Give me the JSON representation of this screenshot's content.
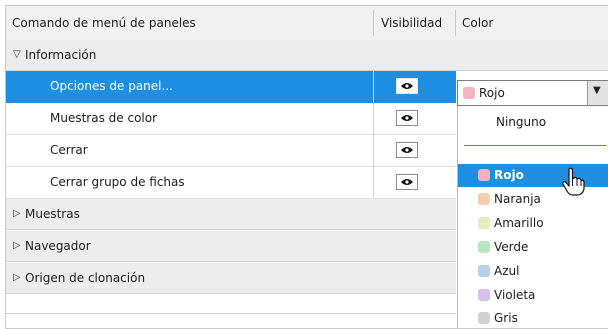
{
  "header": {
    "col_command": "Comando de menú de paneles",
    "col_visibility": "Visibilidad",
    "col_color": "Color"
  },
  "groups": [
    {
      "label": "Información",
      "expanded": true,
      "icon": "triangle-down-icon"
    },
    {
      "label": "Muestras",
      "expanded": false,
      "icon": "triangle-right-icon"
    },
    {
      "label": "Navegador",
      "expanded": false,
      "icon": "triangle-right-icon"
    },
    {
      "label": "Origen de clonación",
      "expanded": false,
      "icon": "triangle-right-icon"
    }
  ],
  "rows": [
    {
      "label": "Opciones de panel...",
      "visible": true,
      "selected": true
    },
    {
      "label": "Muestras de color",
      "visible": true,
      "selected": false
    },
    {
      "label": "Cerrar",
      "visible": true,
      "selected": false
    },
    {
      "label": "Cerrar grupo de fichas",
      "visible": true,
      "selected": false
    }
  ],
  "color_dropdown": {
    "value": "Rojo",
    "swatch": "#f0b4bd",
    "options_none": "Ninguno",
    "options": [
      {
        "label": "Rojo",
        "color": "#f0b4bd",
        "selected": true
      },
      {
        "label": "Naranja",
        "color": "#f5cdb0",
        "selected": false
      },
      {
        "label": "Amarillo",
        "color": "#ece9be",
        "selected": false
      },
      {
        "label": "Verde",
        "color": "#b8e6bd",
        "selected": false
      },
      {
        "label": "Azul",
        "color": "#b7d0ec",
        "selected": false
      },
      {
        "label": "Violeta",
        "color": "#d8c0ec",
        "selected": false
      },
      {
        "label": "Gris",
        "color": "#d2d2d2",
        "selected": false
      }
    ]
  },
  "colors": {
    "selection": "#1e8ee0",
    "header_bg": "#f1f1f1",
    "group_bg": "#ececec"
  }
}
